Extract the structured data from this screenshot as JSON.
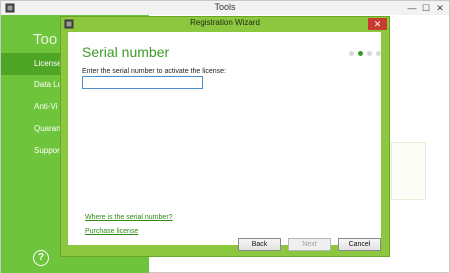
{
  "window": {
    "title": "Tools",
    "minimize_glyph": "—",
    "maximize_glyph": "☐",
    "close_glyph": "✕"
  },
  "sidebar": {
    "title": "Too",
    "items": [
      {
        "label": "License",
        "active": true
      },
      {
        "label": "Data Lo",
        "active": false
      },
      {
        "label": "Anti-Vi",
        "active": false
      },
      {
        "label": "Quaran",
        "active": false
      },
      {
        "label": "Suppor",
        "active": false
      }
    ],
    "help_glyph": "?"
  },
  "dialog": {
    "title": "Registration Wizard",
    "close_glyph": "✕",
    "heading": "Serial number",
    "prompt": "Enter the serial number to activate the license:",
    "serial_value": "",
    "steps": {
      "total": 4,
      "current": 2
    },
    "links": {
      "where_serial": "Where is the serial number?",
      "purchase": "Purchase license"
    },
    "buttons": {
      "back": "Back",
      "next": "Next",
      "cancel": "Cancel"
    }
  },
  "colors": {
    "sidebar": "#6ec43a",
    "sidebar_active": "#4fa625",
    "dialog_frame": "#8dc63f",
    "accent_text": "#3a9b24",
    "close": "#c83a2f"
  }
}
